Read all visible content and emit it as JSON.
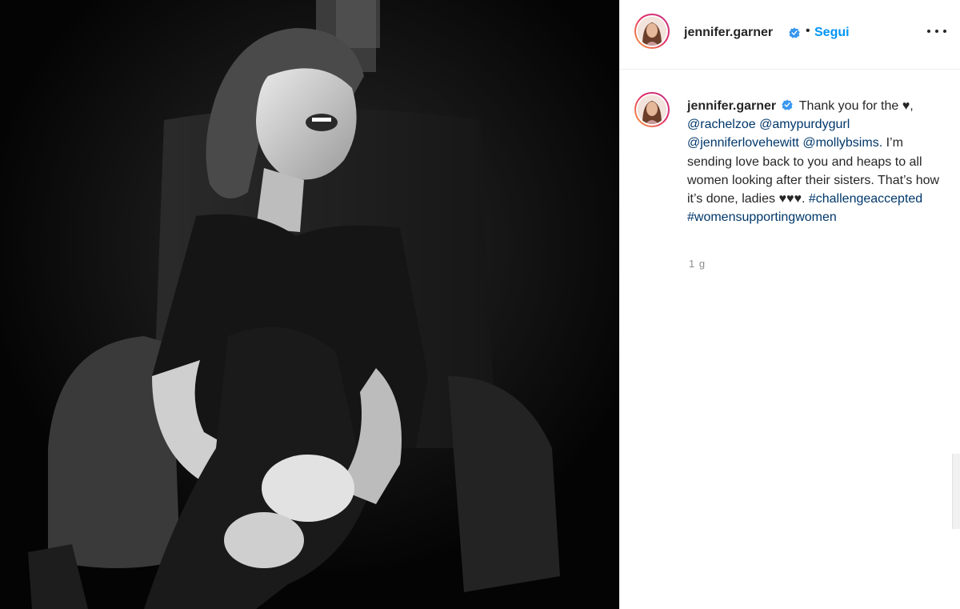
{
  "post": {
    "username": "jennifer.garner",
    "follow_separator": "•",
    "follow_label": "Segui",
    "more_icon": "more-horizontal-icon",
    "caption_prefix": "Thank you for the",
    "caption_heart": "♥,",
    "mentions": [
      "@rachelzoe",
      "@amypurdygurl",
      "@jenniferlovehewitt",
      "@mollybsims."
    ],
    "caption_body": "I’m sending love back to you and heaps to all women looking after their sisters. That’s how it’s done, ladies",
    "caption_hearts": "♥♥♥.",
    "hashtags": [
      "#challengeaccepted",
      "#womensupportingwomen"
    ],
    "time_ago": "1 g"
  },
  "colors": {
    "link": "#0095f6",
    "tag": "#00376b",
    "verified": "#3897f0",
    "muted": "#8e8e8e"
  }
}
